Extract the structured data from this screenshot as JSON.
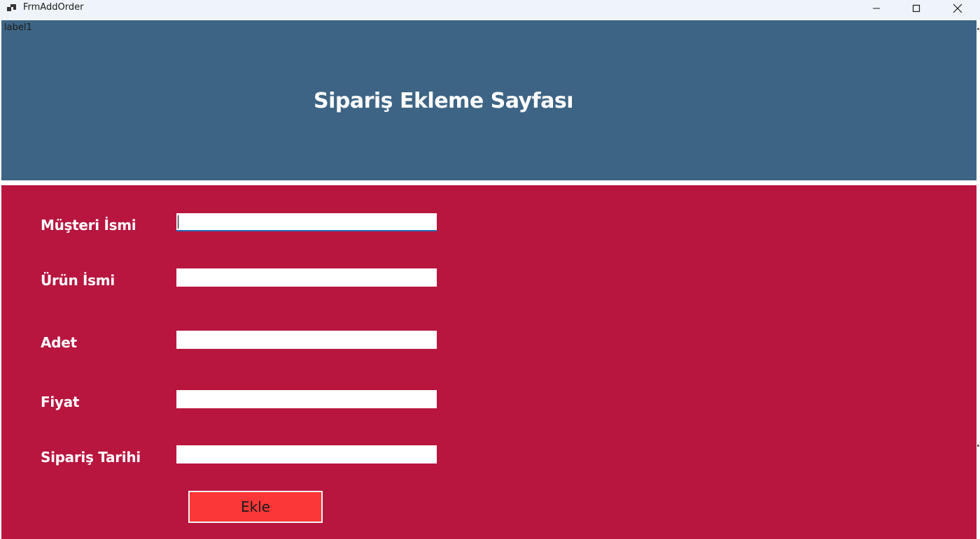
{
  "window": {
    "title": "FrmAddOrder",
    "icon": "app-window-icon",
    "controls": [
      "minimize-icon",
      "maximize-icon",
      "close-icon"
    ]
  },
  "header": {
    "label1": "label1",
    "title": "Sipariş Ekleme Sayfası",
    "background": "#3d6484"
  },
  "form": {
    "background": "#b8163f",
    "fields": [
      {
        "label": "Müşteri İsmi",
        "value": ""
      },
      {
        "label": "Ürün İsmi",
        "value": ""
      },
      {
        "label": "Adet",
        "value": ""
      },
      {
        "label": "Fiyat",
        "value": ""
      },
      {
        "label": "Sipariş Tarihi",
        "value": ""
      }
    ],
    "submit_label": "Ekle",
    "submit_color": "#fc3737"
  }
}
